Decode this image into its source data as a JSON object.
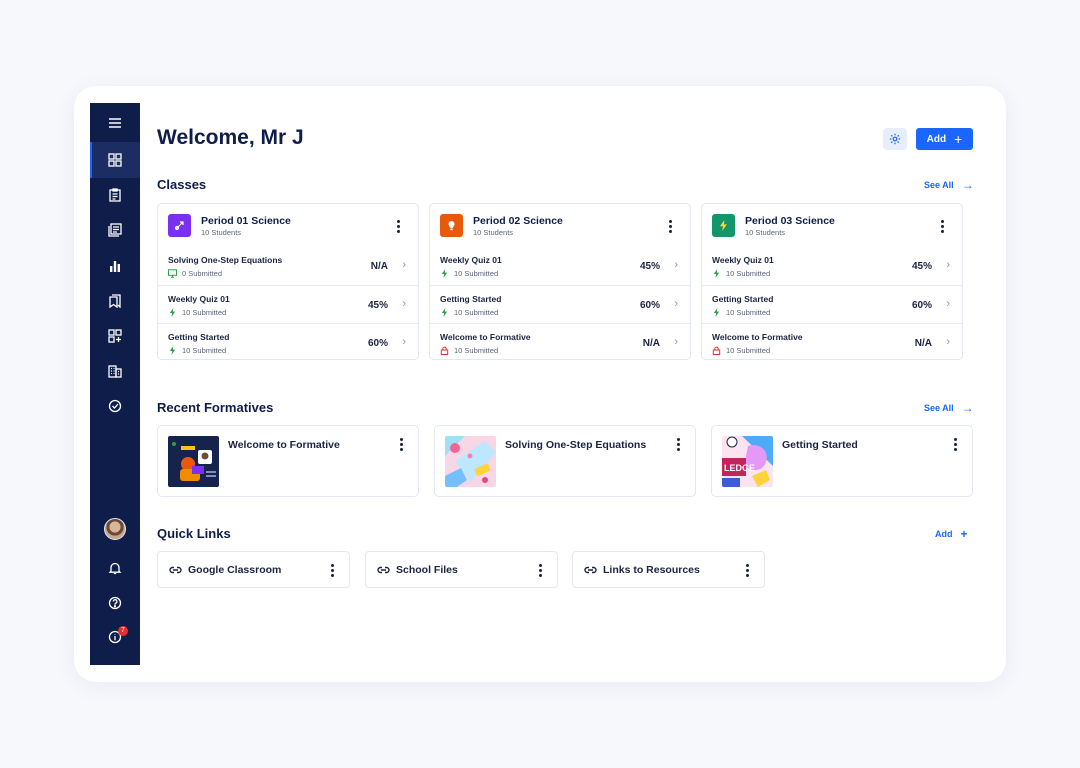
{
  "header": {
    "title": "Welcome, Mr J",
    "add_label": "Add"
  },
  "sidebar": {
    "items": [
      {
        "icon": "menu-icon"
      },
      {
        "icon": "dashboard-icon"
      },
      {
        "icon": "clipboard-icon"
      },
      {
        "icon": "library-icon"
      },
      {
        "icon": "reports-icon"
      },
      {
        "icon": "bookmarks-icon"
      },
      {
        "icon": "add-apps-icon"
      },
      {
        "icon": "school-icon"
      },
      {
        "icon": "check-badge-icon"
      }
    ],
    "notification_count": "7"
  },
  "classes": {
    "heading": "Classes",
    "see_all": "See All",
    "cards": [
      {
        "name": "Period 01 Science",
        "students": "10 Students",
        "color": "#7b2ff0",
        "rows": [
          {
            "title": "Solving One-Step Equations",
            "sub": "0 Submitted",
            "value": "N/A",
            "icon": "monitor-icon"
          },
          {
            "title": "Weekly Quiz 01",
            "sub": "10 Submitted",
            "value": "45%",
            "icon": "bolt-icon"
          },
          {
            "title": "Getting Started",
            "sub": "10 Submitted",
            "value": "60%",
            "icon": "bolt-icon"
          }
        ]
      },
      {
        "name": "Period 02 Science",
        "students": "10 Students",
        "color": "#e8590c",
        "rows": [
          {
            "title": "Weekly Quiz 01",
            "sub": "10 Submitted",
            "value": "45%",
            "icon": "bolt-icon"
          },
          {
            "title": "Getting Started",
            "sub": "10 Submitted",
            "value": "60%",
            "icon": "bolt-icon"
          },
          {
            "title": "Welcome to Formative",
            "sub": "10 Submitted",
            "value": "N/A",
            "icon": "lock-icon"
          }
        ]
      },
      {
        "name": "Period 03 Science",
        "students": "10 Students",
        "color": "#12966b",
        "rows": [
          {
            "title": "Weekly Quiz 01",
            "sub": "10 Submitted",
            "value": "45%",
            "icon": "bolt-icon"
          },
          {
            "title": "Getting Started",
            "sub": "10 Submitted",
            "value": "60%",
            "icon": "bolt-icon"
          },
          {
            "title": "Welcome to Formative",
            "sub": "10 Submitted",
            "value": "N/A",
            "icon": "lock-icon"
          }
        ]
      }
    ]
  },
  "recent": {
    "heading": "Recent Formatives",
    "see_all": "See All",
    "cards": [
      {
        "title": "Welcome to Formative"
      },
      {
        "title": "Solving One-Step Equations"
      },
      {
        "title": "Getting Started",
        "thumb_text": "LEDGE"
      }
    ]
  },
  "quick_links": {
    "heading": "Quick Links",
    "add_label": "Add",
    "links": [
      {
        "label": "Google Classroom"
      },
      {
        "label": "School Files"
      },
      {
        "label": "Links to Resources"
      }
    ]
  },
  "colors": {
    "accent": "#1a66ff",
    "sidebar": "#0f1d4a",
    "bolt": "#2f9e44",
    "lock": "#e03131"
  }
}
